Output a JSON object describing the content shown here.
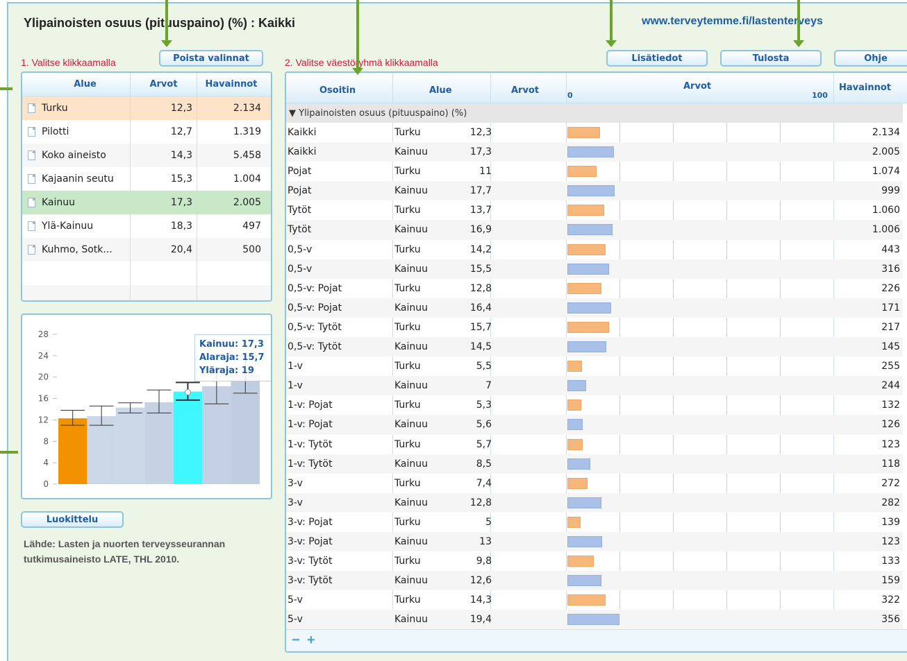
{
  "header": {
    "title": "Ylipainoisten osuus (pituuspaino) (%) : Kaikki",
    "site": "www.terveytemme.fi/lastenterveys"
  },
  "steps": {
    "step1": "1. Valitse klikkaamalla",
    "step2": "2. Valitse väestöryhmä klikkaamalla"
  },
  "buttons": {
    "clear": "Poista valinnat",
    "info": "Lisätiedot",
    "print": "Tulosta",
    "help": "Ohje",
    "classify": "Luokittelu"
  },
  "region_table": {
    "columns": [
      "Alue",
      "Arvot",
      "Havainnot"
    ],
    "rows": [
      {
        "alue": "Turku",
        "arvot": "12,3",
        "havainnot": "2.134",
        "state": "orange"
      },
      {
        "alue": "Pilotti",
        "arvot": "12,7",
        "havainnot": "1.319",
        "state": ""
      },
      {
        "alue": "Koko aineisto",
        "arvot": "14,3",
        "havainnot": "5.458",
        "state": ""
      },
      {
        "alue": "Kajaanin seutu",
        "arvot": "15,3",
        "havainnot": "1.004",
        "state": ""
      },
      {
        "alue": "Kainuu",
        "arvot": "17,3",
        "havainnot": "2.005",
        "state": "green"
      },
      {
        "alue": "Ylä-Kainuu",
        "arvot": "18,3",
        "havainnot": "497",
        "state": ""
      },
      {
        "alue": "Kuhmo, Sotk...",
        "arvot": "20,4",
        "havainnot": "500",
        "state": ""
      }
    ]
  },
  "tooltip": {
    "line1": "Kainuu: 17,3",
    "line2": "Alaraja: 15,7",
    "line3": "Yläraja: 19"
  },
  "chart_data": {
    "type": "bar",
    "yticks": [
      "28",
      "24",
      "20",
      "16",
      "12",
      "8",
      "4",
      "0"
    ],
    "ylim": [
      0,
      28
    ],
    "bars": [
      {
        "value": 12.3,
        "low": 11,
        "high": 13.8,
        "color": "#f39200"
      },
      {
        "value": 12.7,
        "low": 11,
        "high": 14.6,
        "color": "#cbd6e6"
      },
      {
        "value": 14.3,
        "low": 13.3,
        "high": 15.2,
        "color": "#cbd6e6"
      },
      {
        "value": 15.3,
        "low": 13.3,
        "high": 17.6,
        "color": "#c6d2e4"
      },
      {
        "value": 17.3,
        "low": 15.7,
        "high": 19,
        "color": "#3ef7ff"
      },
      {
        "value": 18.3,
        "low": 15,
        "high": 21.5,
        "color": "#c4d0e3"
      },
      {
        "value": 20.4,
        "low": 17,
        "high": 24,
        "color": "#c0cde1"
      }
    ]
  },
  "data_table": {
    "columns": {
      "osoitin": "Osoitin",
      "alue": "Alue",
      "arvot": "Arvot",
      "arvot_bar": "Arvot",
      "scale_min": "0",
      "scale_max": "100",
      "havainnot": "Havainnot"
    },
    "group": "▼ Ylipainoisten osuus (pituuspaino) (%)",
    "rows": [
      {
        "osoitin": "Kaikki",
        "alue": "Turku",
        "arvot": "12,3",
        "value": 12.3,
        "havainnot": "2.134"
      },
      {
        "osoitin": "Kaikki",
        "alue": "Kainuu",
        "arvot": "17,3",
        "value": 17.3,
        "havainnot": "2.005"
      },
      {
        "osoitin": "Pojat",
        "alue": "Turku",
        "arvot": "11",
        "value": 11,
        "havainnot": "1.074"
      },
      {
        "osoitin": "Pojat",
        "alue": "Kainuu",
        "arvot": "17,7",
        "value": 17.7,
        "havainnot": "999"
      },
      {
        "osoitin": "Tytöt",
        "alue": "Turku",
        "arvot": "13,7",
        "value": 13.7,
        "havainnot": "1.060"
      },
      {
        "osoitin": "Tytöt",
        "alue": "Kainuu",
        "arvot": "16,9",
        "value": 16.9,
        "havainnot": "1.006"
      },
      {
        "osoitin": "0,5-v",
        "alue": "Turku",
        "arvot": "14,2",
        "value": 14.2,
        "havainnot": "443"
      },
      {
        "osoitin": "0,5-v",
        "alue": "Kainuu",
        "arvot": "15,5",
        "value": 15.5,
        "havainnot": "316"
      },
      {
        "osoitin": "0,5-v: Pojat",
        "alue": "Turku",
        "arvot": "12,8",
        "value": 12.8,
        "havainnot": "226"
      },
      {
        "osoitin": "0,5-v: Pojat",
        "alue": "Kainuu",
        "arvot": "16,4",
        "value": 16.4,
        "havainnot": "171"
      },
      {
        "osoitin": "0,5-v: Tytöt",
        "alue": "Turku",
        "arvot": "15,7",
        "value": 15.7,
        "havainnot": "217"
      },
      {
        "osoitin": "0,5-v: Tytöt",
        "alue": "Kainuu",
        "arvot": "14,5",
        "value": 14.5,
        "havainnot": "145"
      },
      {
        "osoitin": "1-v",
        "alue": "Turku",
        "arvot": "5,5",
        "value": 5.5,
        "havainnot": "255"
      },
      {
        "osoitin": "1-v",
        "alue": "Kainuu",
        "arvot": "7",
        "value": 7,
        "havainnot": "244"
      },
      {
        "osoitin": "1-v: Pojat",
        "alue": "Turku",
        "arvot": "5,3",
        "value": 5.3,
        "havainnot": "132"
      },
      {
        "osoitin": "1-v: Pojat",
        "alue": "Kainuu",
        "arvot": "5,6",
        "value": 5.6,
        "havainnot": "126"
      },
      {
        "osoitin": "1-v: Tytöt",
        "alue": "Turku",
        "arvot": "5,7",
        "value": 5.7,
        "havainnot": "123"
      },
      {
        "osoitin": "1-v: Tytöt",
        "alue": "Kainuu",
        "arvot": "8,5",
        "value": 8.5,
        "havainnot": "118"
      },
      {
        "osoitin": "3-v",
        "alue": "Turku",
        "arvot": "7,4",
        "value": 7.4,
        "havainnot": "272"
      },
      {
        "osoitin": "3-v",
        "alue": "Kainuu",
        "arvot": "12,8",
        "value": 12.8,
        "havainnot": "282"
      },
      {
        "osoitin": "3-v: Pojat",
        "alue": "Turku",
        "arvot": "5",
        "value": 5,
        "havainnot": "139"
      },
      {
        "osoitin": "3-v: Pojat",
        "alue": "Kainuu",
        "arvot": "13",
        "value": 13,
        "havainnot": "123"
      },
      {
        "osoitin": "3-v: Tytöt",
        "alue": "Turku",
        "arvot": "9,8",
        "value": 9.8,
        "havainnot": "133"
      },
      {
        "osoitin": "3-v: Tytöt",
        "alue": "Kainuu",
        "arvot": "12,6",
        "value": 12.6,
        "havainnot": "159"
      },
      {
        "osoitin": "5-v",
        "alue": "Turku",
        "arvot": "14,3",
        "value": 14.3,
        "havainnot": "322"
      },
      {
        "osoitin": "5-v",
        "alue": "Kainuu",
        "arvot": "19,4",
        "value": 19.4,
        "havainnot": "356"
      }
    ],
    "bar_colors": {
      "Turku": "#f8b77a",
      "Kainuu": "#a9c1e8"
    },
    "footer_minus": "−",
    "footer_plus": "+"
  },
  "source": "Lähde: Lasten ja nuorten terveysseurannan tutkimusaineisto LATE, THL 2010.",
  "colors": {
    "accent": "#1f5da6",
    "border": "#8fc4e0",
    "background": "#edf6e6",
    "step_red": "#d0173f",
    "arrow_green": "#6aa52a"
  }
}
